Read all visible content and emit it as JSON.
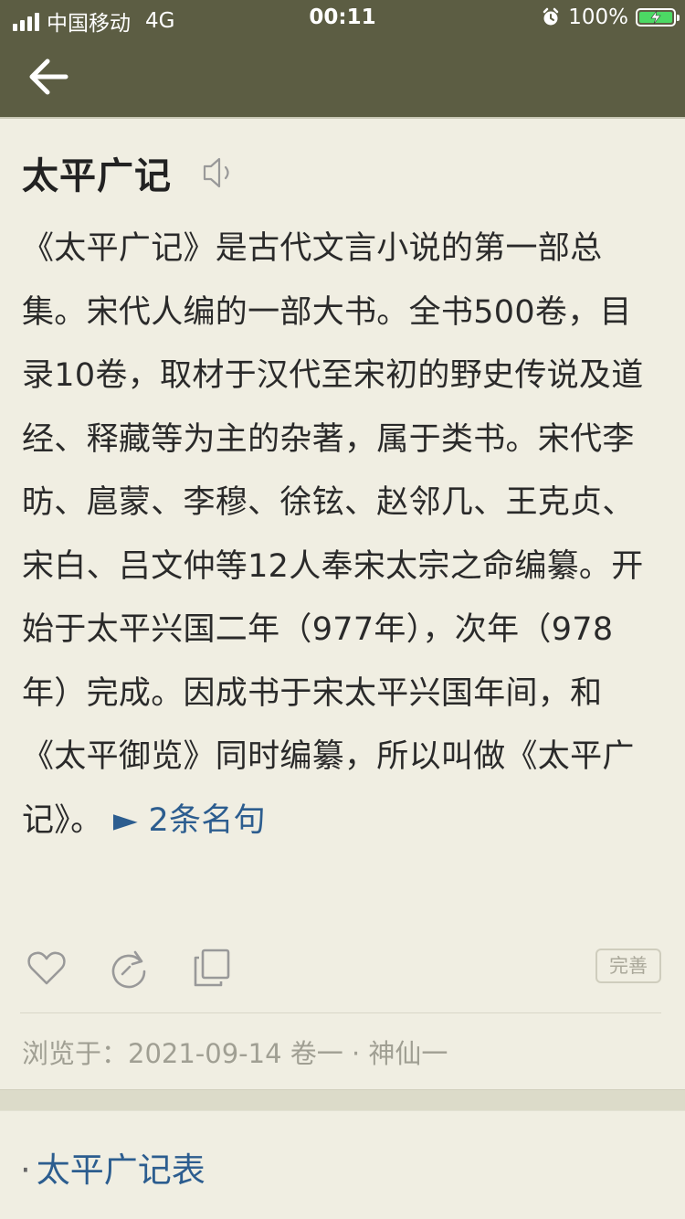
{
  "status_bar": {
    "carrier": "中国移动",
    "network": "4G",
    "time": "00:11",
    "battery": "100%",
    "battery_color": "#4cd964"
  },
  "nav": {
    "back_icon": "arrow-left-icon"
  },
  "article": {
    "title": "太平广记",
    "speaker_icon": "speaker-icon",
    "body": "《太平广记》是古代文言小说的第一部总集。宋代人编的一部大书。全书500卷，目录10卷，取材于汉代至宋初的野史传说及道经、释藏等为主的杂著，属于类书。宋代李昉、扈蒙、李穆、徐铉、赵邻几、王克贞、宋白、吕文仲等12人奉宋太宗之命编纂。开始于太平兴国二年（977年），次年（978年）完成。因成书于宋太平兴国年间，和《太平御览》同时编纂，所以叫做《太平广记》。",
    "quotes_link": "► 2条名句",
    "link_color": "#2c5d8f"
  },
  "actions": {
    "like_icon": "heart-icon",
    "share_icon": "share-icon",
    "copy_icon": "copy-icon",
    "perfect_label": "完善"
  },
  "browsed": "浏览于：2021-09-14 卷一 · 神仙一",
  "related": {
    "bullet": "·",
    "label": "太平广记表"
  }
}
